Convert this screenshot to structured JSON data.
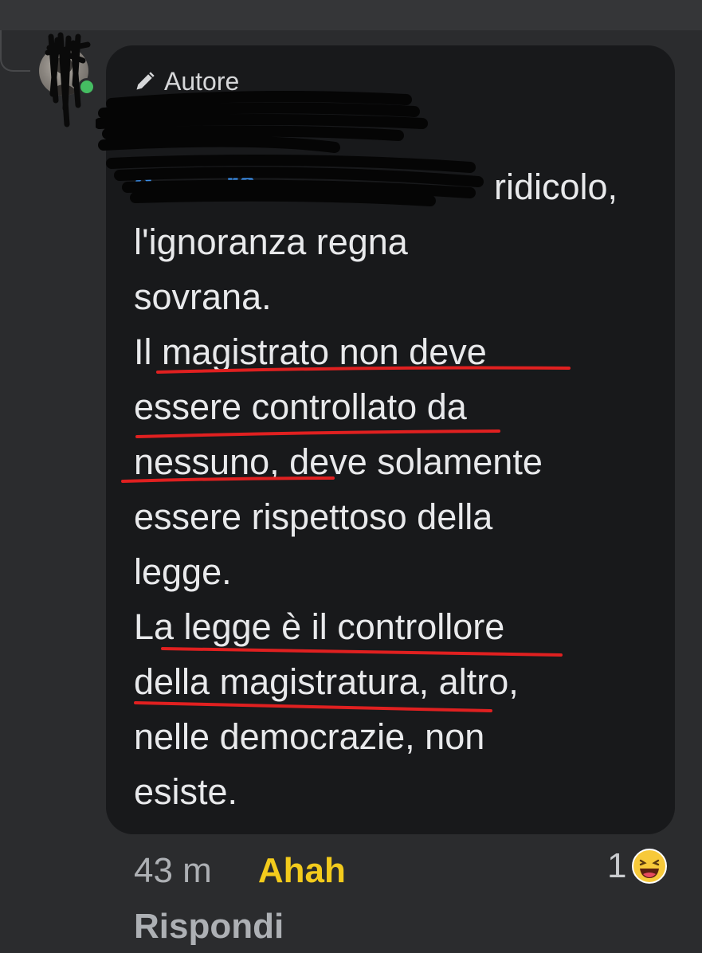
{
  "comment": {
    "author_tag": "Autore",
    "mention_partial": "d… …re",
    "lines": [
      "ridicolo,",
      "l'ignoranza regna",
      "sovrana.",
      "Il magistrato non deve",
      "essere controllato da",
      "nessuno, deve solamente",
      "essere rispettoso della",
      "legge.",
      "La legge è il controllore",
      "della magistratura, altro,",
      "nelle democrazie, non",
      "esiste."
    ]
  },
  "footer": {
    "time": "43 m",
    "reaction_link": "Ahah",
    "reply_link": "Rispondi",
    "reaction_count": "1"
  },
  "colors": {
    "background": "#2b2c2e",
    "bubble": "#18191b",
    "mention_blue": "#3c8ee8",
    "reaction_yellow": "#f3cb1c",
    "underline_red": "#e02020",
    "online_green": "#45bd62"
  },
  "icons": {
    "author": "pencil-icon",
    "reaction": "laughing-emoji-icon"
  }
}
